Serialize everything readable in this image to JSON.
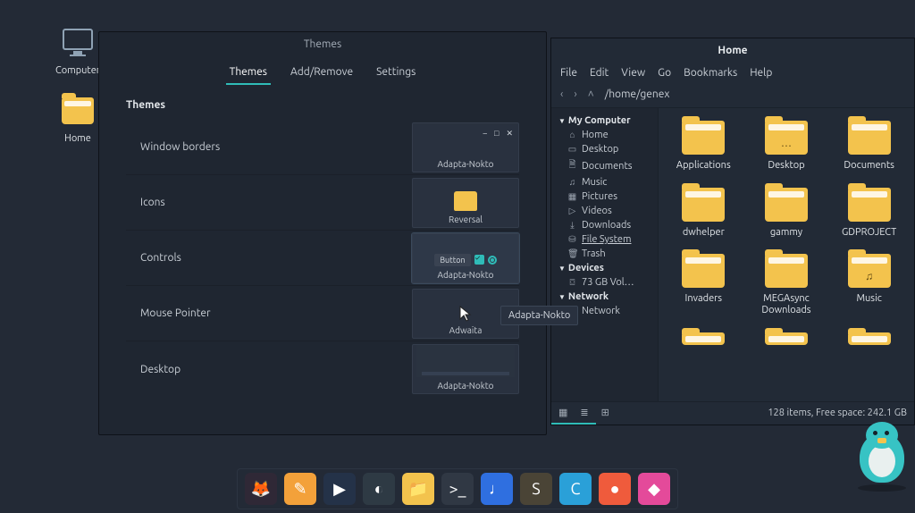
{
  "desktop": {
    "icons": [
      {
        "name": "computer",
        "label": "Computer"
      },
      {
        "name": "home",
        "label": "Home"
      }
    ]
  },
  "themes_window": {
    "title": "Themes",
    "tabs": [
      "Themes",
      "Add/Remove",
      "Settings"
    ],
    "active_tab": 0,
    "heading": "Themes",
    "rows": [
      {
        "key": "window-borders",
        "label": "Window borders",
        "value": "Adapta-Nokto",
        "kind": "titlebar"
      },
      {
        "key": "icons",
        "label": "Icons",
        "value": "Reversal",
        "kind": "icon"
      },
      {
        "key": "controls",
        "label": "Controls",
        "value": "Adapta-Nokto",
        "kind": "controls",
        "button_label": "Button"
      },
      {
        "key": "mouse-pointer",
        "label": "Mouse Pointer",
        "value": "Adwaita",
        "kind": "cursor"
      },
      {
        "key": "desktop",
        "label": "Desktop",
        "value": "Adapta-Nokto",
        "kind": "desktop"
      }
    ],
    "tooltip": "Adapta-Nokto"
  },
  "file_manager": {
    "title": "Home",
    "menu": [
      "File",
      "Edit",
      "View",
      "Go",
      "Bookmarks",
      "Help"
    ],
    "toolbar": {
      "nav": [
        "‹",
        "›",
        "˄"
      ],
      "path": "/home/genex"
    },
    "sidebar": {
      "sections": [
        {
          "title": "My Computer",
          "items": [
            {
              "icon": "⌂",
              "label": "Home"
            },
            {
              "icon": "▭",
              "label": "Desktop"
            },
            {
              "icon": "🗎",
              "label": "Documents"
            },
            {
              "icon": "♫",
              "label": "Music"
            },
            {
              "icon": "▦",
              "label": "Pictures"
            },
            {
              "icon": "▷",
              "label": "Videos"
            },
            {
              "icon": "⤓",
              "label": "Downloads"
            },
            {
              "icon": "⛁",
              "label": "File System",
              "underline": true
            },
            {
              "icon": "🗑",
              "label": "Trash"
            }
          ]
        },
        {
          "title": "Devices",
          "items": [
            {
              "icon": "⌼",
              "label": "73 GB Vol…"
            }
          ]
        },
        {
          "title": "Network",
          "items": [
            {
              "icon": "↻",
              "label": "Network"
            }
          ]
        }
      ]
    },
    "folders": [
      {
        "label": "Applications",
        "mark": ""
      },
      {
        "label": "Desktop",
        "mark": "…"
      },
      {
        "label": "Documents",
        "mark": ""
      },
      {
        "label": "dwhelper",
        "mark": ""
      },
      {
        "label": "gammy",
        "mark": ""
      },
      {
        "label": "GDPROJECT",
        "mark": ""
      },
      {
        "label": "Invaders",
        "mark": ""
      },
      {
        "label": "MEGAsync Downloads",
        "mark": ""
      },
      {
        "label": "Music",
        "mark": "♫"
      }
    ],
    "partial_row": [
      {
        "label": ""
      },
      {
        "label": ""
      },
      {
        "label": ""
      }
    ],
    "status": "128 items, Free space: 242.1 GB"
  },
  "dock": [
    {
      "name": "firefox",
      "bg": "#2f2836",
      "glyph": "🦊"
    },
    {
      "name": "notes",
      "bg": "#f3a13a",
      "glyph": "✎"
    },
    {
      "name": "video",
      "bg": "#243248",
      "glyph": "▶"
    },
    {
      "name": "monitor",
      "bg": "#2e3a44",
      "glyph": "◐"
    },
    {
      "name": "files",
      "bg": "#f3c34d",
      "glyph": "📁"
    },
    {
      "name": "terminal",
      "bg": "#303844",
      "glyph": ">_"
    },
    {
      "name": "joplin",
      "bg": "#2f6fe0",
      "glyph": "♩"
    },
    {
      "name": "sublime",
      "bg": "#4a4436",
      "glyph": "S"
    },
    {
      "name": "code",
      "bg": "#2aa0d8",
      "glyph": "C"
    },
    {
      "name": "recorder",
      "bg": "#ef5b3c",
      "glyph": "●"
    },
    {
      "name": "app-pink",
      "bg": "#e44a9a",
      "glyph": "◆"
    }
  ]
}
